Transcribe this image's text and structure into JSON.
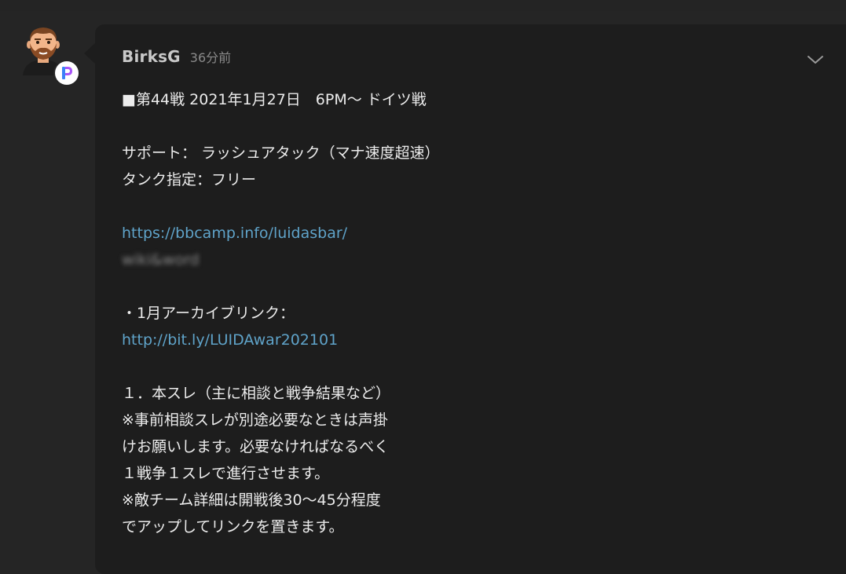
{
  "post": {
    "author": "BirksG",
    "timestamp": "36分前",
    "lines": {
      "l1": "■第44戦 2021年1月27日　6PM～ ドイツ戦",
      "l2": "サポート： ラッシュアタック（マナ速度超速）",
      "l3": "タンク指定：フリー",
      "l4": "https://bbcamp.info/luidasbar/",
      "l5": "wiki&word",
      "l6": "・1月アーカイブリンク：",
      "l7": "http://bit.ly/LUIDAwar202101",
      "l8": "１．本スレ（主に相談と戦争結果など）",
      "l9": "※事前相談スレが別途必要なときは声掛",
      "l10": "けお願いします。必要なければなるべく",
      "l11": "１戦争１スレで進行させます。",
      "l12": "※敵チーム詳細は開戦後30～45分程度",
      "l13": "でアップしてリンクを置きます。"
    }
  },
  "icons": {
    "avatar": "bearded-man-avatar",
    "badge": "app-badge-icon",
    "expand": "chevron-down-icon"
  },
  "colors": {
    "background": "#252525",
    "bubble": "#1d1d1d",
    "text": "#ececec",
    "link": "#5fa3c9",
    "muted": "#8a8a8a"
  }
}
